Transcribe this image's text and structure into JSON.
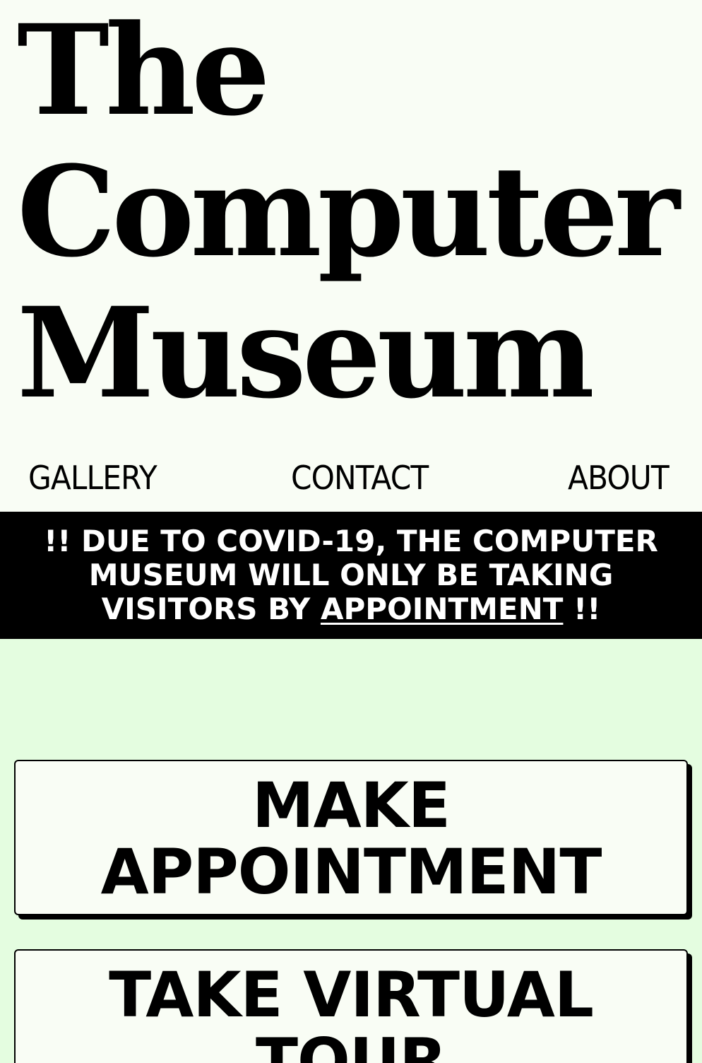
{
  "site": {
    "title_lines": [
      "The",
      "Computer",
      "Museum"
    ]
  },
  "nav": {
    "items": [
      {
        "label": "GALLERY"
      },
      {
        "label": "CONTACT"
      },
      {
        "label": "ABOUT"
      }
    ]
  },
  "banner": {
    "text_before": "!! DUE TO COVID-19, THE COMPUTER MUSEUM WILL ONLY BE TAKING VISITORS BY ",
    "link_label": "APPOINTMENT",
    "text_after": " !!"
  },
  "actions": {
    "make_appointment_label": "MAKE APPOINTMENT",
    "virtual_tour_label": "TAKE VIRTUAL TOUR"
  },
  "colors": {
    "header_background": "#f9fdf5",
    "page_background": "#e4fde0",
    "banner_background": "#000000",
    "banner_text": "#ffffff",
    "text": "#000000"
  }
}
